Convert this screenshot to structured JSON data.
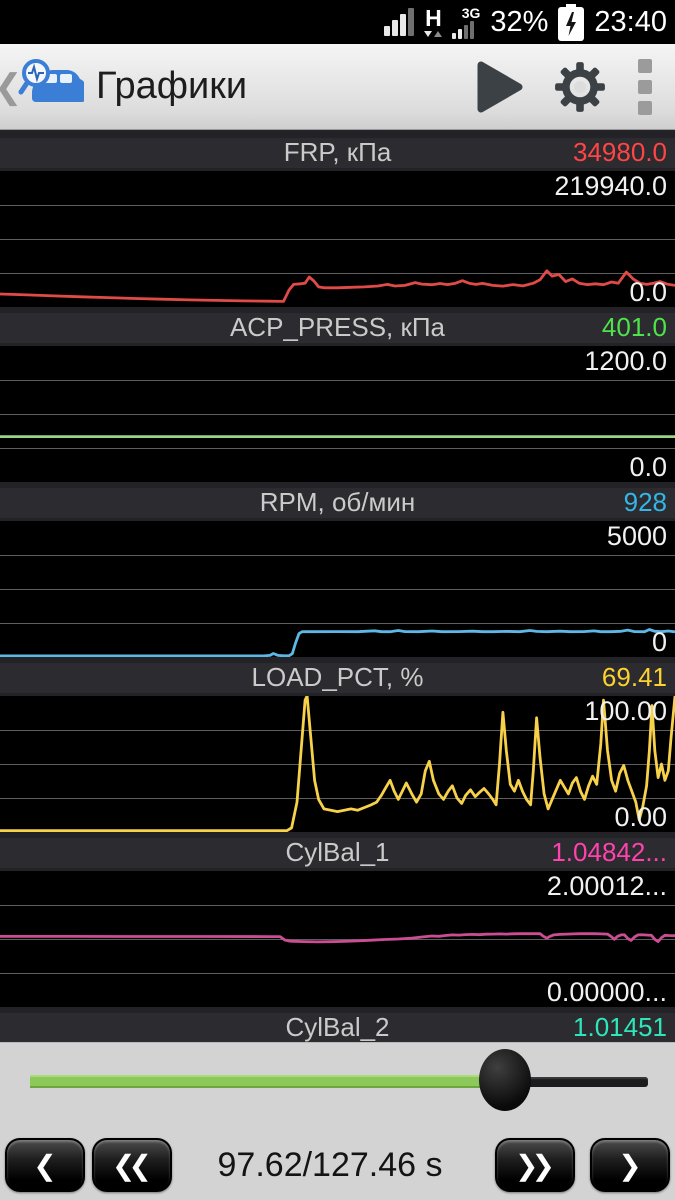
{
  "status_bar": {
    "battery_percent": "32%",
    "time": "23:40",
    "network_h_label": "H",
    "network_3g_label": "3G"
  },
  "app_bar": {
    "title": "Графики"
  },
  "panels": [
    {
      "title": "FRP, кПа",
      "value": "34980.0",
      "value_color": "#ff4545",
      "max_label": "219940.0",
      "min_label": "0.0"
    },
    {
      "title": "ACP_PRESS, кПа",
      "value": "401.0",
      "value_color": "#4fe34b",
      "max_label": "1200.0",
      "min_label": "0.0"
    },
    {
      "title": "RPM, об/мин",
      "value": "928",
      "value_color": "#34b6e8",
      "max_label": "5000",
      "min_label": "0"
    },
    {
      "title": "LOAD_PCT, %",
      "value": "69.41",
      "value_color": "#fed22e",
      "max_label": "100.00",
      "min_label": "0.00"
    },
    {
      "title": "CylBal_1",
      "value": "1.04842...",
      "value_color": "#ff42ad",
      "max_label": "2.00012...",
      "min_label": "0.00000..."
    },
    {
      "title": "CylBal_2",
      "value": "1.01451",
      "value_color": "#2fe5ba",
      "max_label": "",
      "min_label": ""
    }
  ],
  "chart_data": [
    {
      "type": "line",
      "name": "FRP",
      "unit": "кПа",
      "current_value": 34980.0,
      "ylim": [
        0,
        219940
      ],
      "color": "#e04b47",
      "grid": true,
      "legend_position": "none",
      "points": [
        [
          0,
          21000
        ],
        [
          0.04,
          19500
        ],
        [
          0.08,
          18000
        ],
        [
          0.12,
          16500
        ],
        [
          0.16,
          15200
        ],
        [
          0.2,
          13800
        ],
        [
          0.24,
          12600
        ],
        [
          0.28,
          11500
        ],
        [
          0.32,
          10600
        ],
        [
          0.36,
          9900
        ],
        [
          0.4,
          9300
        ],
        [
          0.42,
          9000
        ],
        [
          0.428,
          27000
        ],
        [
          0.435,
          36500
        ],
        [
          0.445,
          37500
        ],
        [
          0.452,
          38500
        ],
        [
          0.458,
          48500
        ],
        [
          0.465,
          42000
        ],
        [
          0.472,
          32500
        ],
        [
          0.48,
          31000
        ],
        [
          0.5,
          31000
        ],
        [
          0.52,
          31800
        ],
        [
          0.54,
          32500
        ],
        [
          0.56,
          34000
        ],
        [
          0.574,
          36500
        ],
        [
          0.585,
          34000
        ],
        [
          0.6,
          35000
        ],
        [
          0.615,
          39500
        ],
        [
          0.625,
          37000
        ],
        [
          0.64,
          36000
        ],
        [
          0.652,
          38000
        ],
        [
          0.663,
          36200
        ],
        [
          0.675,
          38500
        ],
        [
          0.685,
          42500
        ],
        [
          0.695,
          38500
        ],
        [
          0.705,
          36500
        ],
        [
          0.715,
          38200
        ],
        [
          0.73,
          35000
        ],
        [
          0.745,
          33800
        ],
        [
          0.76,
          36200
        ],
        [
          0.775,
          34200
        ],
        [
          0.79,
          38500
        ],
        [
          0.8,
          44000
        ],
        [
          0.81,
          58500
        ],
        [
          0.818,
          50000
        ],
        [
          0.828,
          52500
        ],
        [
          0.838,
          41000
        ],
        [
          0.848,
          45500
        ],
        [
          0.858,
          38500
        ],
        [
          0.87,
          36200
        ],
        [
          0.882,
          37500
        ],
        [
          0.894,
          36000
        ],
        [
          0.906,
          40500
        ],
        [
          0.916,
          38500
        ],
        [
          0.928,
          56500
        ],
        [
          0.938,
          45500
        ],
        [
          0.948,
          38500
        ],
        [
          0.958,
          36500
        ],
        [
          0.968,
          38500
        ],
        [
          0.978,
          41000
        ],
        [
          0.988,
          37000
        ],
        [
          1,
          34980
        ]
      ]
    },
    {
      "type": "line",
      "name": "ACP_PRESS",
      "unit": "кПа",
      "current_value": 401.0,
      "ylim": [
        0,
        1200
      ],
      "color": "#9ad684",
      "grid": true,
      "legend_position": "none",
      "points": [
        [
          0,
          401
        ],
        [
          0.25,
          401
        ],
        [
          0.5,
          401
        ],
        [
          0.75,
          401
        ],
        [
          1,
          401
        ]
      ]
    },
    {
      "type": "line",
      "name": "RPM",
      "unit": "об/мин",
      "current_value": 928,
      "ylim": [
        0,
        5000
      ],
      "color": "#5cb8e6",
      "grid": true,
      "legend_position": "none",
      "points": [
        [
          0,
          40
        ],
        [
          0.39,
          40
        ],
        [
          0.4,
          60
        ],
        [
          0.405,
          130
        ],
        [
          0.412,
          60
        ],
        [
          0.42,
          45
        ],
        [
          0.428,
          45
        ],
        [
          0.433,
          120
        ],
        [
          0.438,
          520
        ],
        [
          0.443,
          860
        ],
        [
          0.448,
          935
        ],
        [
          0.46,
          930
        ],
        [
          0.5,
          935
        ],
        [
          0.53,
          930
        ],
        [
          0.555,
          965
        ],
        [
          0.565,
          930
        ],
        [
          0.578,
          930
        ],
        [
          0.59,
          975
        ],
        [
          0.6,
          935
        ],
        [
          0.62,
          930
        ],
        [
          0.64,
          955
        ],
        [
          0.655,
          930
        ],
        [
          0.68,
          935
        ],
        [
          0.7,
          950
        ],
        [
          0.715,
          930
        ],
        [
          0.73,
          930
        ],
        [
          0.75,
          940
        ],
        [
          0.77,
          930
        ],
        [
          0.785,
          975
        ],
        [
          0.795,
          940
        ],
        [
          0.81,
          930
        ],
        [
          0.83,
          950
        ],
        [
          0.845,
          930
        ],
        [
          0.865,
          935
        ],
        [
          0.88,
          960
        ],
        [
          0.89,
          930
        ],
        [
          0.905,
          930
        ],
        [
          0.92,
          945
        ],
        [
          0.93,
          990
        ],
        [
          0.94,
          935
        ],
        [
          0.955,
          930
        ],
        [
          0.962,
          1010
        ],
        [
          0.97,
          945
        ],
        [
          0.98,
          930
        ],
        [
          0.99,
          955
        ],
        [
          1,
          928
        ]
      ]
    },
    {
      "type": "line",
      "name": "LOAD_PCT",
      "unit": "%",
      "current_value": 69.41,
      "ylim": [
        0,
        100
      ],
      "color": "#f7d149",
      "grid": true,
      "legend_position": "none",
      "points": [
        [
          0,
          1
        ],
        [
          0.425,
          1
        ],
        [
          0.432,
          3
        ],
        [
          0.44,
          22
        ],
        [
          0.446,
          60
        ],
        [
          0.452,
          97
        ],
        [
          0.455,
          100
        ],
        [
          0.46,
          72
        ],
        [
          0.466,
          38
        ],
        [
          0.472,
          24
        ],
        [
          0.48,
          17
        ],
        [
          0.49,
          16
        ],
        [
          0.5,
          15
        ],
        [
          0.51,
          16
        ],
        [
          0.52,
          17
        ],
        [
          0.53,
          16
        ],
        [
          0.54,
          18
        ],
        [
          0.55,
          20
        ],
        [
          0.558,
          22
        ],
        [
          0.565,
          27
        ],
        [
          0.572,
          33
        ],
        [
          0.578,
          38
        ],
        [
          0.584,
          30
        ],
        [
          0.59,
          24
        ],
        [
          0.596,
          30
        ],
        [
          0.602,
          36
        ],
        [
          0.61,
          28
        ],
        [
          0.617,
          22
        ],
        [
          0.624,
          28
        ],
        [
          0.63,
          45
        ],
        [
          0.636,
          52
        ],
        [
          0.642,
          38
        ],
        [
          0.65,
          28
        ],
        [
          0.657,
          24
        ],
        [
          0.664,
          30
        ],
        [
          0.67,
          34
        ],
        [
          0.677,
          25
        ],
        [
          0.684,
          21
        ],
        [
          0.69,
          27
        ],
        [
          0.697,
          31
        ],
        [
          0.704,
          26
        ],
        [
          0.71,
          29
        ],
        [
          0.717,
          32
        ],
        [
          0.724,
          28
        ],
        [
          0.73,
          24
        ],
        [
          0.735,
          20
        ],
        [
          0.74,
          50
        ],
        [
          0.745,
          88
        ],
        [
          0.75,
          60
        ],
        [
          0.756,
          35
        ],
        [
          0.762,
          30
        ],
        [
          0.768,
          38
        ],
        [
          0.774,
          30
        ],
        [
          0.78,
          24
        ],
        [
          0.786,
          20
        ],
        [
          0.79,
          45
        ],
        [
          0.795,
          84
        ],
        [
          0.8,
          55
        ],
        [
          0.806,
          28
        ],
        [
          0.812,
          17
        ],
        [
          0.818,
          24
        ],
        [
          0.824,
          31
        ],
        [
          0.83,
          38
        ],
        [
          0.836,
          33
        ],
        [
          0.842,
          28
        ],
        [
          0.848,
          36
        ],
        [
          0.854,
          40
        ],
        [
          0.86,
          30
        ],
        [
          0.866,
          24
        ],
        [
          0.872,
          34
        ],
        [
          0.878,
          41
        ],
        [
          0.884,
          35
        ],
        [
          0.89,
          65
        ],
        [
          0.894,
          97
        ],
        [
          0.9,
          60
        ],
        [
          0.906,
          38
        ],
        [
          0.912,
          30
        ],
        [
          0.918,
          43
        ],
        [
          0.924,
          49
        ],
        [
          0.93,
          38
        ],
        [
          0.936,
          30
        ],
        [
          0.942,
          22
        ],
        [
          0.947,
          9
        ],
        [
          0.952,
          18
        ],
        [
          0.958,
          34
        ],
        [
          0.962,
          60
        ],
        [
          0.966,
          93
        ],
        [
          0.97,
          60
        ],
        [
          0.975,
          40
        ],
        [
          0.98,
          50
        ],
        [
          0.985,
          38
        ],
        [
          0.99,
          45
        ],
        [
          0.994,
          69
        ],
        [
          1,
          100
        ]
      ]
    },
    {
      "type": "line",
      "name": "CylBal_1",
      "unit": "",
      "current_value": 1.04842,
      "ylim": [
        0,
        2.00012
      ],
      "color": "#cb4d94",
      "grid": true,
      "legend_position": "none",
      "points": [
        [
          0,
          1.038
        ],
        [
          0.1,
          1.038
        ],
        [
          0.2,
          1.037
        ],
        [
          0.3,
          1.037
        ],
        [
          0.4,
          1.036
        ],
        [
          0.415,
          1.035
        ],
        [
          0.422,
          0.985
        ],
        [
          0.43,
          0.968
        ],
        [
          0.45,
          0.962
        ],
        [
          0.47,
          0.958
        ],
        [
          0.49,
          0.96
        ],
        [
          0.51,
          0.965
        ],
        [
          0.53,
          0.972
        ],
        [
          0.55,
          0.982
        ],
        [
          0.57,
          0.992
        ],
        [
          0.59,
          1.0
        ],
        [
          0.61,
          1.012
        ],
        [
          0.625,
          1.03
        ],
        [
          0.64,
          1.044
        ],
        [
          0.65,
          1.04
        ],
        [
          0.66,
          1.052
        ],
        [
          0.67,
          1.06
        ],
        [
          0.68,
          1.058
        ],
        [
          0.69,
          1.065
        ],
        [
          0.7,
          1.068
        ],
        [
          0.71,
          1.064
        ],
        [
          0.72,
          1.07
        ],
        [
          0.73,
          1.072
        ],
        [
          0.74,
          1.075
        ],
        [
          0.75,
          1.072
        ],
        [
          0.76,
          1.076
        ],
        [
          0.77,
          1.078
        ],
        [
          0.78,
          1.08
        ],
        [
          0.79,
          1.078
        ],
        [
          0.8,
          1.08
        ],
        [
          0.805,
          1.04
        ],
        [
          0.81,
          1.012
        ],
        [
          0.815,
          1.04
        ],
        [
          0.82,
          1.06
        ],
        [
          0.83,
          1.068
        ],
        [
          0.84,
          1.072
        ],
        [
          0.85,
          1.075
        ],
        [
          0.86,
          1.078
        ],
        [
          0.87,
          1.08
        ],
        [
          0.88,
          1.078
        ],
        [
          0.89,
          1.075
        ],
        [
          0.9,
          1.072
        ],
        [
          0.905,
          1.04
        ],
        [
          0.91,
          0.995
        ],
        [
          0.915,
          1.04
        ],
        [
          0.92,
          1.06
        ],
        [
          0.925,
          1.062
        ],
        [
          0.93,
          1.008
        ],
        [
          0.935,
          0.98
        ],
        [
          0.94,
          1.03
        ],
        [
          0.945,
          1.06
        ],
        [
          0.95,
          1.062
        ],
        [
          0.955,
          1.06
        ],
        [
          0.96,
          1.058
        ],
        [
          0.965,
          1.055
        ],
        [
          0.97,
          0.995
        ],
        [
          0.975,
          0.962
        ],
        [
          0.98,
          1.02
        ],
        [
          0.985,
          1.055
        ],
        [
          0.99,
          1.052
        ],
        [
          1,
          1.048
        ]
      ]
    },
    {
      "type": "line",
      "name": "CylBal_2",
      "unit": "",
      "current_value": 1.01451,
      "ylim": null,
      "color": "#2fe5ba",
      "grid": true,
      "legend_position": "none",
      "points": null
    }
  ],
  "slider": {
    "progress_fraction": 0.766,
    "track_color": "#8cc95a"
  },
  "controls": {
    "time_label": "97.62/127.46 s",
    "step_back_glyph": "❮",
    "rewind_glyph": "❮❮",
    "fast_forward_glyph": "❯❯",
    "step_forward_glyph": "❯"
  }
}
